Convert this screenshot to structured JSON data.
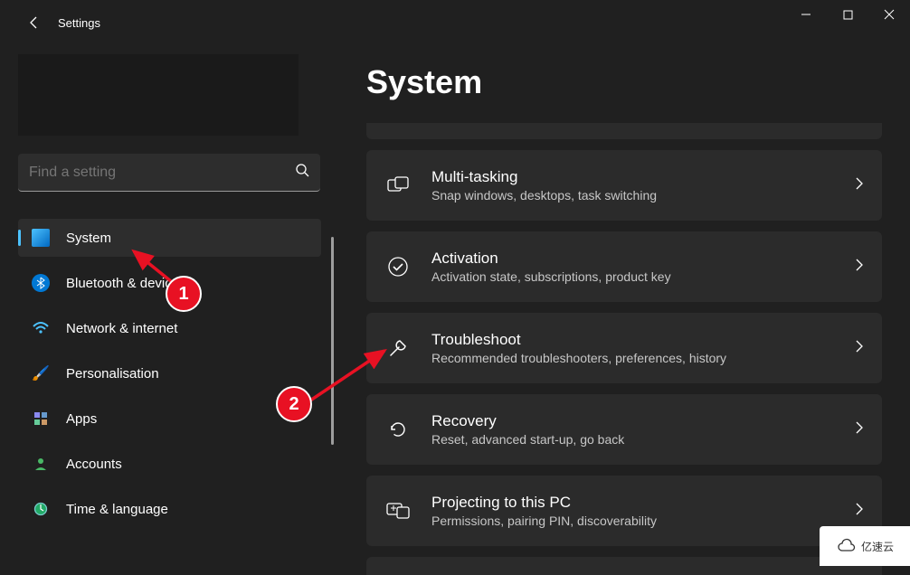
{
  "window": {
    "title": "Settings"
  },
  "search": {
    "placeholder": "Find a setting"
  },
  "sidebar": {
    "items": [
      {
        "label": "System",
        "icon": "system",
        "active": true
      },
      {
        "label": "Bluetooth & devices",
        "icon": "bluetooth",
        "active": false
      },
      {
        "label": "Network & internet",
        "icon": "network",
        "active": false
      },
      {
        "label": "Personalisation",
        "icon": "personal",
        "active": false
      },
      {
        "label": "Apps",
        "icon": "apps",
        "active": false
      },
      {
        "label": "Accounts",
        "icon": "accounts",
        "active": false
      },
      {
        "label": "Time & language",
        "icon": "time",
        "active": false
      }
    ]
  },
  "page": {
    "title": "System"
  },
  "settings": [
    {
      "title": "Multi-tasking",
      "subtitle": "Snap windows, desktops, task switching",
      "icon": "multitask"
    },
    {
      "title": "Activation",
      "subtitle": "Activation state, subscriptions, product key",
      "icon": "activation"
    },
    {
      "title": "Troubleshoot",
      "subtitle": "Recommended troubleshooters, preferences, history",
      "icon": "troubleshoot"
    },
    {
      "title": "Recovery",
      "subtitle": "Reset, advanced start-up, go back",
      "icon": "recovery"
    },
    {
      "title": "Projecting to this PC",
      "subtitle": "Permissions, pairing PIN, discoverability",
      "icon": "projecting"
    }
  ],
  "annotations": {
    "marker1": "1",
    "marker2": "2"
  },
  "watermark": "亿速云"
}
